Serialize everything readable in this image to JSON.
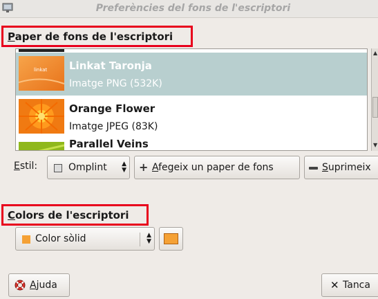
{
  "window": {
    "title": "Preferències del fons de l'escriptori"
  },
  "wallpaper_section": {
    "header_mnemonic": "P",
    "header_rest": "aper de fons de l'escriptori",
    "items": [
      {
        "name": "Linkat Taronja",
        "type": "Imatge PNG (532K)",
        "selected": true,
        "thumb_label": "linkat"
      },
      {
        "name": "Orange Flower",
        "type": "Imatge JPEG (83K)",
        "selected": false
      },
      {
        "name": "Parallel Veins",
        "type": "",
        "selected": false
      }
    ],
    "style_label_mnemonic": "E",
    "style_label_rest": "stil:",
    "style_value": "Omplint",
    "add_button_mnemonic": "A",
    "add_button_rest": "fegeix un paper de fons",
    "remove_button_mnemonic": "S",
    "remove_button_rest": "uprimeix"
  },
  "colors_section": {
    "header_mnemonic": "C",
    "header_rest": "olors de l'escriptori",
    "mode_value": "Color sòlid",
    "color": "#f5a135"
  },
  "buttons": {
    "help_mnemonic": "A",
    "help_rest": "juda",
    "close_label": "Tanca"
  },
  "icons": {
    "app": "display-properties-icon",
    "help": "lifebuoy-icon",
    "close": "close-x-icon",
    "add": "plus-icon",
    "remove": "minus-icon"
  }
}
